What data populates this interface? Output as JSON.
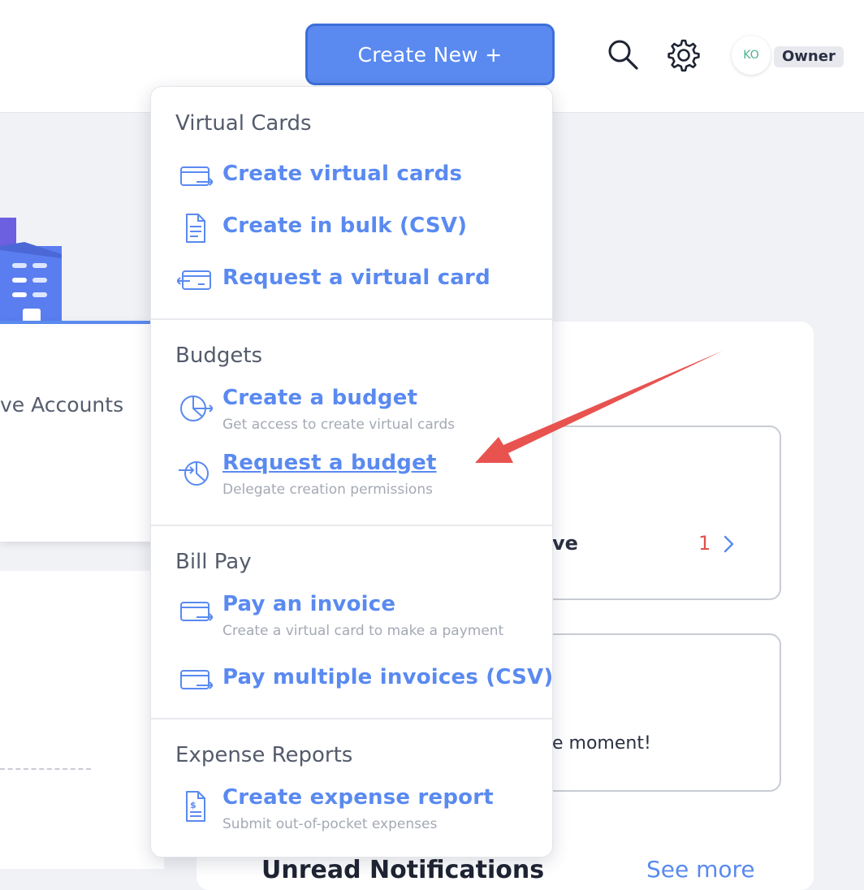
{
  "header": {
    "create_button_label": "Create New +",
    "avatar_initials": "KO",
    "role_badge": "Owner"
  },
  "background": {
    "left_card_text": "ve Accounts",
    "approval_text": "ve",
    "approval_count": "1",
    "moment_text": "e moment!",
    "notifications_title": "Unread Notifications",
    "see_more": "See more"
  },
  "menu": {
    "sections": [
      {
        "title": "Virtual Cards",
        "items": [
          {
            "label": "Create virtual cards",
            "icon": "card-arrow-icon"
          },
          {
            "label": "Create in bulk (CSV)",
            "icon": "document-icon"
          },
          {
            "label": "Request a virtual card",
            "icon": "card-request-icon"
          }
        ]
      },
      {
        "title": "Budgets",
        "items": [
          {
            "label": "Create a budget",
            "sub": "Get access to create virtual cards",
            "icon": "pie-chart-arrow-icon"
          },
          {
            "label": "Request a budget",
            "sub": "Delegate creation permissions",
            "icon": "pie-chart-request-icon"
          }
        ]
      },
      {
        "title": "Bill Pay",
        "items": [
          {
            "label": "Pay an invoice",
            "sub": "Create a virtual card to make a payment",
            "icon": "card-arrow-icon"
          },
          {
            "label": "Pay multiple invoices (CSV)",
            "icon": "card-arrow-icon"
          }
        ]
      },
      {
        "title": "Expense Reports",
        "items": [
          {
            "label": "Create expense report",
            "sub": "Submit out-of-pocket expenses",
            "icon": "receipt-dollar-icon"
          }
        ]
      }
    ]
  },
  "colors": {
    "accent": "#5a8af0",
    "annotation_arrow": "#e8534f",
    "badge_green": "#48b28a"
  }
}
